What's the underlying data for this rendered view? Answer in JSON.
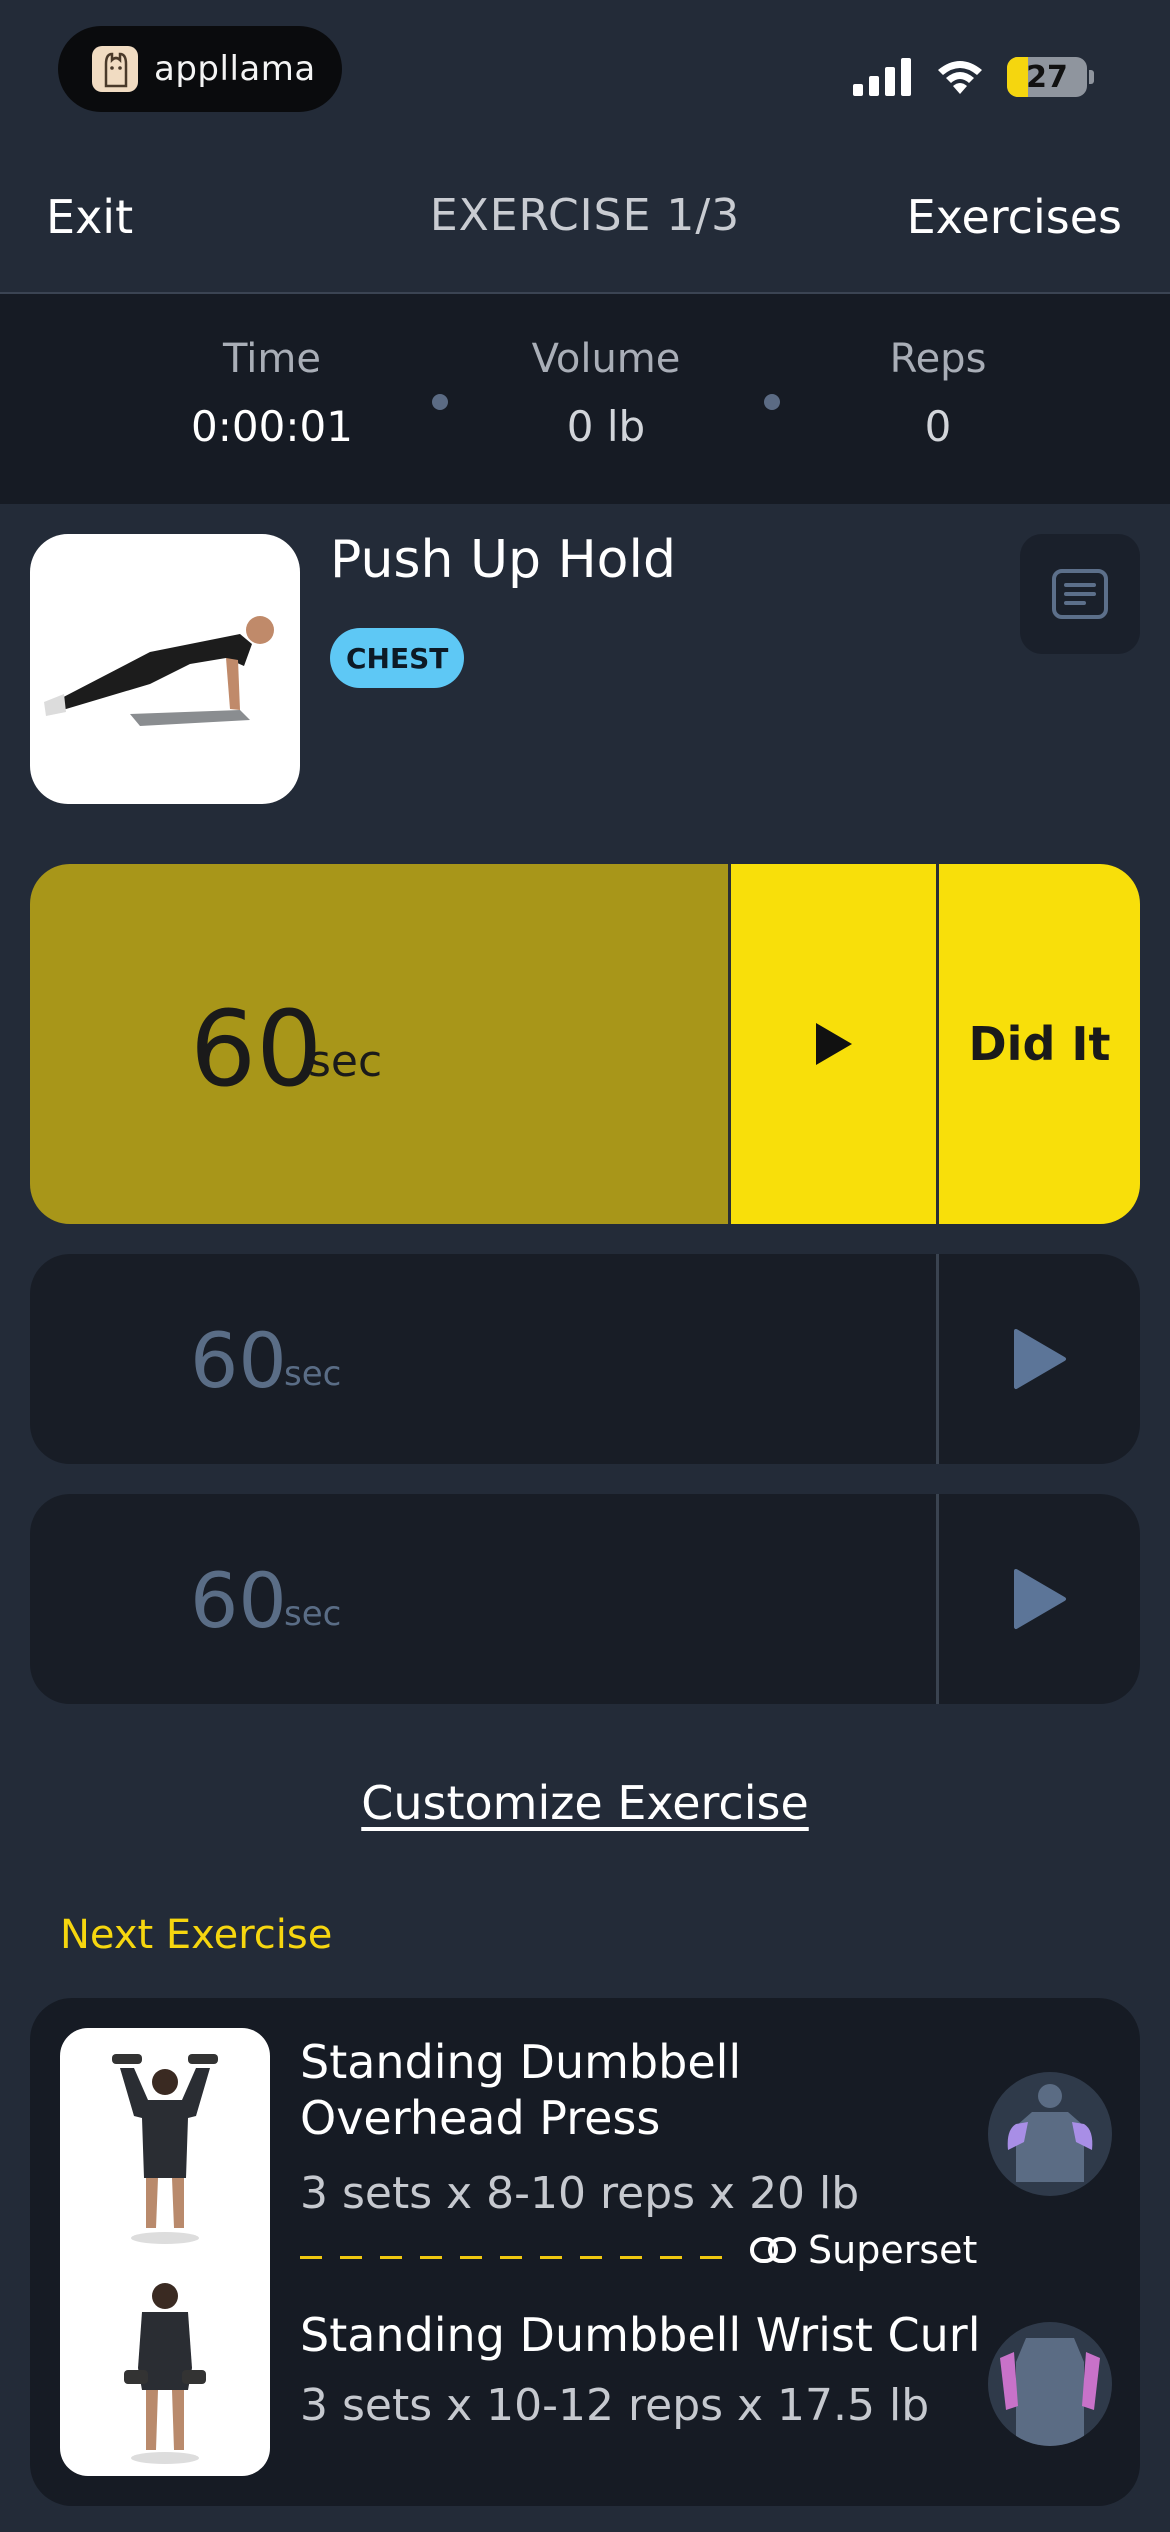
{
  "status_bar": {
    "app_name": "appllama",
    "battery_level": "27"
  },
  "nav": {
    "exit_label": "Exit",
    "title": "EXERCISE 1/3",
    "exercises_label": "Exercises"
  },
  "stats": {
    "time_label": "Time",
    "time_value": "0:00:01",
    "volume_label": "Volume",
    "volume_value": "0 lb",
    "reps_label": "Reps",
    "reps_value": "0"
  },
  "exercise": {
    "name": "Push Up Hold",
    "muscle_tag": "CHEST"
  },
  "sets": [
    {
      "value": "60",
      "unit": "sec",
      "did_it_label": "Did It"
    },
    {
      "value": "60",
      "unit": "sec"
    },
    {
      "value": "60",
      "unit": "sec"
    }
  ],
  "customize_label": "Customize Exercise",
  "next": {
    "section_label": "Next Exercise",
    "items": [
      {
        "name": "Standing Dumbbell Overhead Press",
        "meta": "3 sets x 8-10 reps x 20 lb"
      },
      {
        "name": "Standing Dumbbell Wrist Curl",
        "meta": "3 sets x 10-12 reps x 17.5 lb"
      }
    ],
    "superset_label": "Superset"
  },
  "colors": {
    "background": "#232b38",
    "accent_yellow": "#f8df0a",
    "active_dim": "#a89619",
    "chest_badge": "#5ec8f5"
  }
}
